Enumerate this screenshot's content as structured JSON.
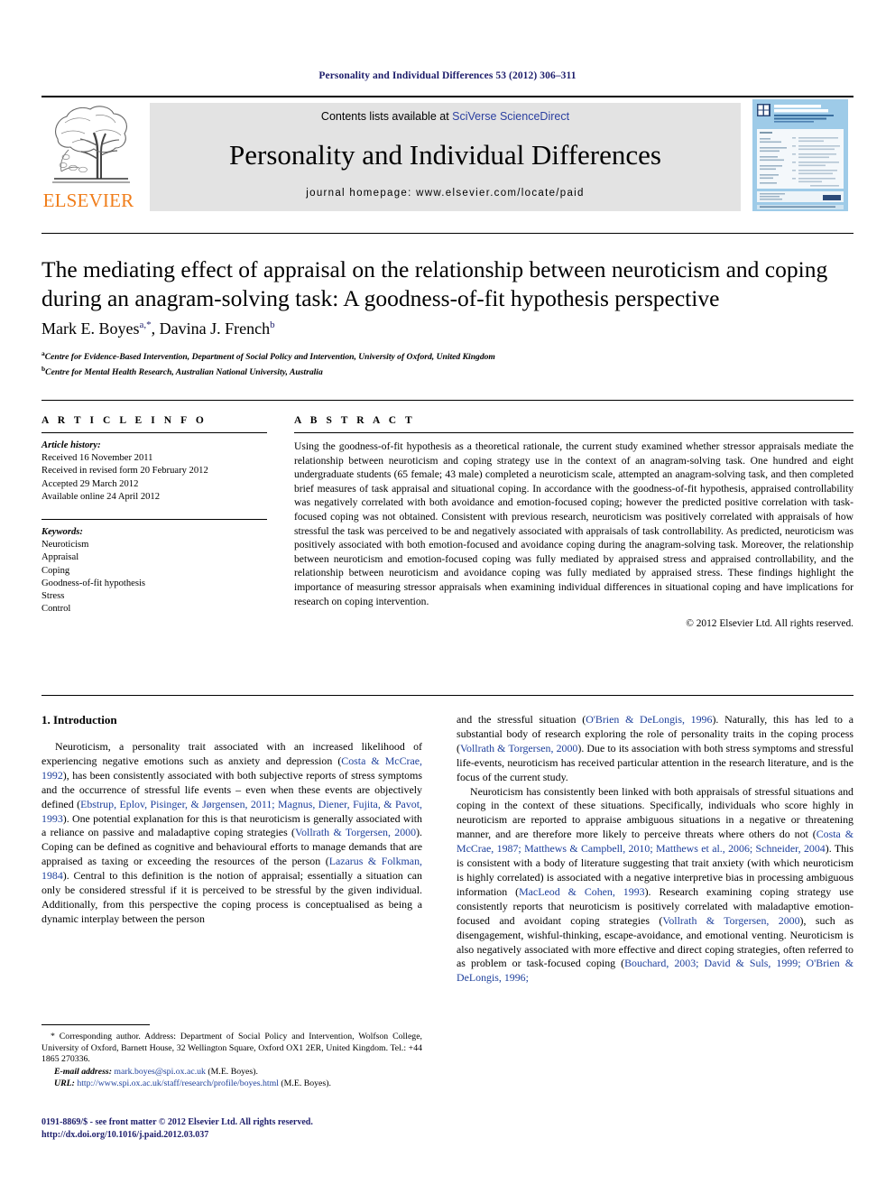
{
  "running_head": "Personality and Individual Differences 53 (2012) 306–311",
  "masthead": {
    "publisher_logo_text": "ELSEVIER",
    "contents_prefix": "Contents lists available at ",
    "contents_link": "SciVerse ScienceDirect",
    "journal_title": "Personality and Individual Differences",
    "homepage": "journal homepage: www.elsevier.com/locate/paid",
    "cover": {
      "title_line1": "PERSONALITY AND",
      "title_line2": "INDIVIDUAL DIFFERENCES",
      "sub_line1": "AN INTERNATIONAL JOURNAL OF RESEARCH",
      "sub_line2": "INTO THE STRUCTURE AND DEVELOPMENT OF PERSONALITY",
      "footer": "OFFICIAL JOURNAL OF THE INTERNATIONAL SOCIETY FOR THE STUDY OF INDIVIDUAL DIFFERENCES"
    }
  },
  "article": {
    "title": "The mediating effect of appraisal on the relationship between neuroticism and coping during an anagram-solving task: A goodness-of-fit hypothesis perspective",
    "authors": [
      {
        "name": "Mark E. Boyes",
        "marks": "a,*"
      },
      {
        "name": "Davina J. French",
        "marks": "b"
      }
    ],
    "affiliations": [
      {
        "mark": "a",
        "text": "Centre for Evidence-Based Intervention, Department of Social Policy and Intervention, University of Oxford, United Kingdom"
      },
      {
        "mark": "b",
        "text": "Centre for Mental Health Research, Australian National University, Australia"
      }
    ]
  },
  "article_info": {
    "heading": "A R T I C L E   I N F O",
    "history_label": "Article history:",
    "history": [
      "Received 16 November 2011",
      "Received in revised form 20 February 2012",
      "Accepted 29 March 2012",
      "Available online 24 April 2012"
    ],
    "keywords_label": "Keywords:",
    "keywords": [
      "Neuroticism",
      "Appraisal",
      "Coping",
      "Goodness-of-fit hypothesis",
      "Stress",
      "Control"
    ]
  },
  "abstract": {
    "heading": "A B S T R A C T",
    "text": "Using the goodness-of-fit hypothesis as a theoretical rationale, the current study examined whether stressor appraisals mediate the relationship between neuroticism and coping strategy use in the context of an anagram-solving task. One hundred and eight undergraduate students (65 female; 43 male) completed a neuroticism scale, attempted an anagram-solving task, and then completed brief measures of task appraisal and situational coping. In accordance with the goodness-of-fit hypothesis, appraised controllability was negatively correlated with both avoidance and emotion-focused coping; however the predicted positive correlation with task-focused coping was not obtained. Consistent with previous research, neuroticism was positively correlated with appraisals of how stressful the task was perceived to be and negatively associated with appraisals of task controllability. As predicted, neuroticism was positively associated with both emotion-focused and avoidance coping during the anagram-solving task. Moreover, the relationship between neuroticism and emotion-focused coping was fully mediated by appraised stress and appraised controllability, and the relationship between neuroticism and avoidance coping was fully mediated by appraised stress. These findings highlight the importance of measuring stressor appraisals when examining individual differences in situational coping and have implications for research on coping intervention.",
    "copyright": "© 2012 Elsevier Ltd. All rights reserved."
  },
  "introduction": {
    "heading": "1. Introduction",
    "left_paragraph_1": "Neuroticism, a personality trait associated with an increased likelihood of experiencing negative emotions such as anxiety and depression (",
    "left_cite_1": "Costa & McCrae, 1992",
    "left_paragraph_1b": "), has been consistently associated with both subjective reports of stress symptoms and the occurrence of stressful life events – even when these events are objectively defined (",
    "left_cite_2": "Ebstrup, Eplov, Pisinger, & Jørgensen, 2011; Magnus, Diener, Fujita, & Pavot, 1993",
    "left_paragraph_1c": "). One potential explanation for this is that neuroticism is generally associated with a reliance on passive and maladaptive coping strategies (",
    "left_cite_3": "Vollrath & Torgersen, 2000",
    "left_paragraph_1d": "). Coping can be defined as cognitive and behavioural efforts to manage demands that are appraised as taxing or exceeding the resources of the person (",
    "left_cite_4": "Lazarus & Folkman, 1984",
    "left_paragraph_1e": "). Central to this definition is the notion of appraisal; essentially a situation can only be considered stressful if it is perceived to be stressful by the given individual. Additionally, from this perspective the coping process is conceptualised as being a dynamic interplay between the person",
    "right_paragraph_1a": "and the stressful situation (",
    "right_cite_1": "O'Brien & DeLongis, 1996",
    "right_paragraph_1b": "). Naturally, this has led to a substantial body of research exploring the role of personality traits in the coping process (",
    "right_cite_2": "Vollrath & Torgersen, 2000",
    "right_paragraph_1c": "). Due to its association with both stress symptoms and stressful life-events, neuroticism has received particular attention in the research literature, and is the focus of the current study.",
    "right_paragraph_2a": "Neuroticism has consistently been linked with both appraisals of stressful situations and coping in the context of these situations. Specifically, individuals who score highly in neuroticism are reported to appraise ambiguous situations in a negative or threatening manner, and are therefore more likely to perceive threats where others do not (",
    "right_cite_3": "Costa & McCrae, 1987; Matthews & Campbell, 2010; Matthews et al., 2006; Schneider, 2004",
    "right_paragraph_2b": "). This is consistent with a body of literature suggesting that trait anxiety (with which neuroticism is highly correlated) is associated with a negative interpretive bias in processing ambiguous information (",
    "right_cite_4": "MacLeod & Cohen, 1993",
    "right_paragraph_2c": "). Research examining coping strategy use consistently reports that neuroticism is positively correlated with maladaptive emotion-focused and avoidant coping strategies (",
    "right_cite_5": "Vollrath & Torgersen, 2000",
    "right_paragraph_2d": "), such as disengagement, wishful-thinking, escape-avoidance, and emotional venting. Neuroticism is also negatively associated with more effective and direct coping strategies, often referred to as problem or task-focused coping (",
    "right_cite_6": "Bouchard, 2003; David & Suls, 1999; O'Brien & DeLongis, 1996;"
  },
  "footnotes": {
    "corresponding": "* Corresponding author. Address: Department of Social Policy and Intervention, Wolfson College, University of Oxford, Barnett House, 32 Wellington Square, Oxford OX1 2ER, United Kingdom. Tel.: +44 1865 270336.",
    "email_label": "E-mail address:",
    "email": "mark.boyes@spi.ox.ac.uk",
    "email_suffix": "(M.E. Boyes).",
    "url_label": "URL:",
    "url": "http://www.spi.ox.ac.uk/staff/research/profile/boyes.html",
    "url_suffix": "(M.E. Boyes)."
  },
  "imprint": {
    "line1": "0191-8869/$ - see front matter © 2012 Elsevier Ltd. All rights reserved.",
    "doi": "http://dx.doi.org/10.1016/j.paid.2012.03.037"
  },
  "colors": {
    "link": "#1d3f9b",
    "running_head": "#1d1d6b",
    "elsevier_orange": "#f07d1a",
    "band_gray": "#e3e3e3",
    "cover_blue": "#9ecbe8"
  }
}
